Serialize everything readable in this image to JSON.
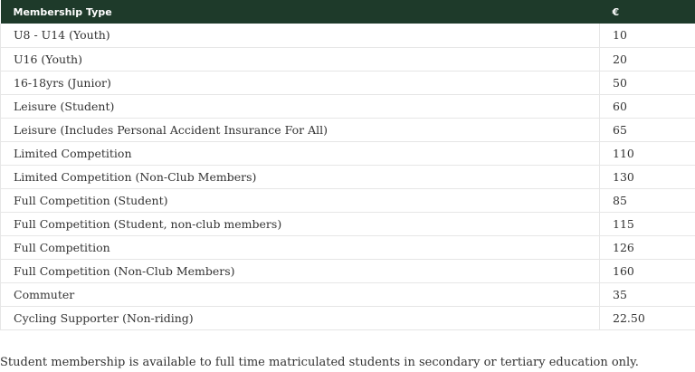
{
  "table": {
    "headers": {
      "type": "Membership Type",
      "price": "€"
    },
    "rows": [
      {
        "type": "U8 - U14 (Youth)",
        "price": "10"
      },
      {
        "type": "U16 (Youth)",
        "price": "20"
      },
      {
        "type": "16-18yrs (Junior)",
        "price": "50"
      },
      {
        "type": "Leisure (Student)",
        "price": "60"
      },
      {
        "type": "Leisure (Includes Personal Accident Insurance For All)",
        "price": "65"
      },
      {
        "type": "Limited Competition",
        "price": "110"
      },
      {
        "type": "Limited Competition (Non-Club Members)",
        "price": "130"
      },
      {
        "type": "Full Competition (Student)",
        "price": "85"
      },
      {
        "type": "Full Competition (Student, non-club members)",
        "price": "115"
      },
      {
        "type": "Full Competition",
        "price": "126"
      },
      {
        "type": "Full Competition (Non-Club Members)",
        "price": "160"
      },
      {
        "type": "Commuter",
        "price": "35"
      },
      {
        "type": "Cycling Supporter (Non-riding)",
        "price": "22.50"
      }
    ]
  },
  "note": "Student membership is available to full time matriculated students in secondary or tertiary education only.",
  "colors": {
    "header_background": "#1e3a2a",
    "header_text": "#ffffff",
    "border": "#e6e6e6"
  }
}
